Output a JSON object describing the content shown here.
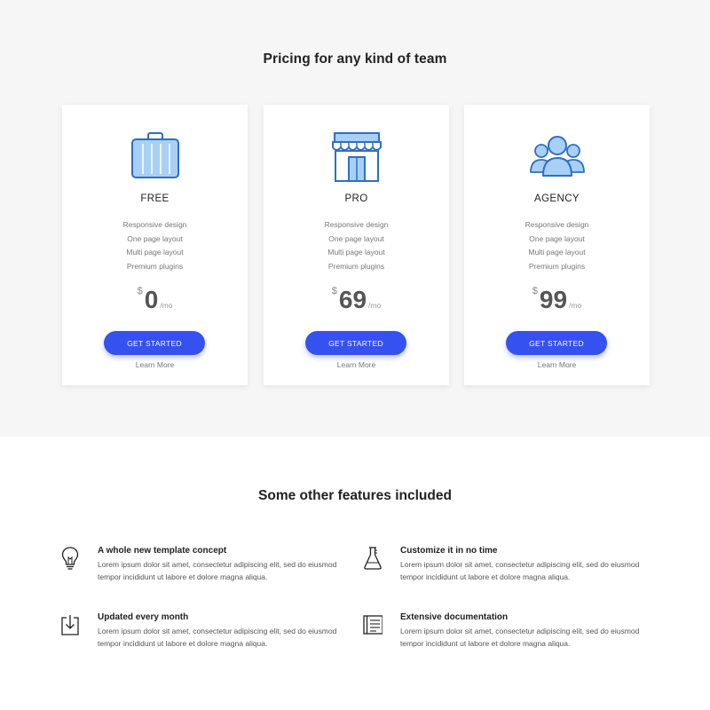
{
  "pricing": {
    "title": "Pricing for any kind of team",
    "accent_color": "#3551f0",
    "plans": [
      {
        "name": "FREE",
        "icon": "briefcase-icon",
        "features": [
          "Responsive design",
          "One page layout",
          "Multi page layout",
          "Premium plugins"
        ],
        "currency": "$",
        "amount": "0",
        "period": "/mo",
        "cta_label": "GET STARTED",
        "learn_label": "Learn More"
      },
      {
        "name": "PRO",
        "icon": "storefront-icon",
        "features": [
          "Responsive design",
          "One page layout",
          "Multi page layout",
          "Premium plugins"
        ],
        "currency": "$",
        "amount": "69",
        "period": "/mo",
        "cta_label": "GET STARTED",
        "learn_label": "Learn More"
      },
      {
        "name": "AGENCY",
        "icon": "team-icon",
        "features": [
          "Responsive design",
          "One page layout",
          "Multi page layout",
          "Premium plugins"
        ],
        "currency": "$",
        "amount": "99",
        "period": "/mo",
        "cta_label": "GET STARTED",
        "learn_label": "Learn More"
      }
    ]
  },
  "features": {
    "title": "Some other features included",
    "items": [
      {
        "icon": "lightbulb-icon",
        "title": "A whole new template concept",
        "description": "Lorem ipsum dolor sit amet, consectetur adipiscing elit, sed do eiusmod tempor incididunt ut labore et dolore magna aliqua."
      },
      {
        "icon": "flask-icon",
        "title": "Customize it in no time",
        "description": "Lorem ipsum dolor sit amet, consectetur adipiscing elit, sed do eiusmod tempor incididunt ut labore et dolore magna aliqua."
      },
      {
        "icon": "download-icon",
        "title": "Updated every month",
        "description": "Lorem ipsum dolor sit amet, consectetur adipiscing elit, sed do eiusmod tempor incididunt ut labore et dolore magna aliqua."
      },
      {
        "icon": "document-icon",
        "title": "Extensive documentation",
        "description": "Lorem ipsum dolor sit amet, consectetur adipiscing elit, sed do eiusmod tempor incididunt ut labore et dolore magna aliqua."
      }
    ]
  }
}
